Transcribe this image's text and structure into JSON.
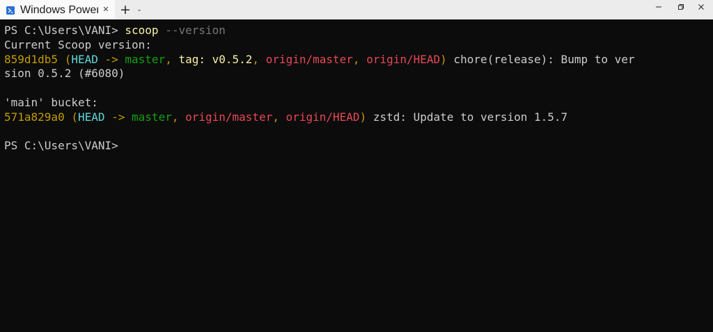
{
  "window": {
    "tab_title": "Windows PowerShell",
    "tab_close": "✕",
    "new_tab": "+",
    "tab_dropdown": "⌄",
    "minimize": "minimize",
    "maximize": "maximize",
    "close": "close"
  },
  "terminal": {
    "lines": [
      {
        "segments": [
          {
            "text": "PS C:\\Users\\VANI> ",
            "color": "default"
          },
          {
            "text": "scoop",
            "color": "cmd"
          },
          {
            "text": " --version",
            "color": "param"
          }
        ]
      },
      {
        "segments": [
          {
            "text": "Current Scoop version:",
            "color": "default"
          }
        ]
      },
      {
        "segments": [
          {
            "text": "859d1db5",
            "color": "yellow"
          },
          {
            "text": " (",
            "color": "yellow"
          },
          {
            "text": "HEAD",
            "color": "head"
          },
          {
            "text": " -> ",
            "color": "yellow"
          },
          {
            "text": "master",
            "color": "green"
          },
          {
            "text": ", ",
            "color": "yellow"
          },
          {
            "text": "tag: v0.5.2",
            "color": "tag"
          },
          {
            "text": ", ",
            "color": "yellow"
          },
          {
            "text": "origin/master",
            "color": "red"
          },
          {
            "text": ", ",
            "color": "yellow"
          },
          {
            "text": "origin/HEAD",
            "color": "red"
          },
          {
            "text": ")",
            "color": "yellow"
          },
          {
            "text": " chore(release): Bump to ver",
            "color": "default"
          }
        ]
      },
      {
        "segments": [
          {
            "text": "sion 0.5.2 (#6080)",
            "color": "default"
          }
        ]
      },
      {
        "segments": []
      },
      {
        "segments": [
          {
            "text": "'main' bucket:",
            "color": "default"
          }
        ]
      },
      {
        "segments": [
          {
            "text": "571a829a0",
            "color": "yellow"
          },
          {
            "text": " (",
            "color": "yellow"
          },
          {
            "text": "HEAD",
            "color": "head"
          },
          {
            "text": " -> ",
            "color": "yellow"
          },
          {
            "text": "master",
            "color": "green"
          },
          {
            "text": ", ",
            "color": "yellow"
          },
          {
            "text": "origin/master",
            "color": "red"
          },
          {
            "text": ", ",
            "color": "yellow"
          },
          {
            "text": "origin/HEAD",
            "color": "red"
          },
          {
            "text": ")",
            "color": "yellow"
          },
          {
            "text": " zstd: Update to version 1.5.7",
            "color": "default"
          }
        ]
      },
      {
        "segments": []
      },
      {
        "segments": [
          {
            "text": "PS C:\\Users\\VANI>",
            "color": "default"
          }
        ]
      }
    ]
  },
  "colors": {
    "background": "#0c0c0c",
    "default": "#cccccc",
    "yellow": "#c19c00",
    "cmd": "#f9f1a5",
    "param": "#767676",
    "head": "#61d6d6",
    "green": "#13a10e",
    "red": "#e74856",
    "tag": "#f9f1a5"
  }
}
